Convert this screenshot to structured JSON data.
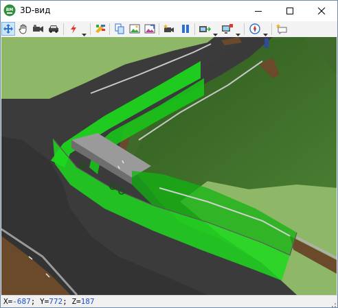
{
  "window": {
    "title": "3D-вид",
    "app_icon_text": "BM"
  },
  "toolbar": {
    "buttons": [
      {
        "name": "move-tool",
        "icon": "four-arrows-icon",
        "active": true
      },
      {
        "name": "pan-hand",
        "icon": "hand-icon"
      },
      {
        "name": "camera-view",
        "icon": "camera-icon"
      },
      {
        "name": "vehicle-view",
        "icon": "car-icon"
      },
      {
        "name": "effects",
        "icon": "lightning-icon",
        "dropdown": true
      },
      {
        "name": "surface-style",
        "icon": "palette-icon"
      },
      {
        "name": "copy-image",
        "icon": "copy-icon"
      },
      {
        "name": "save-image",
        "icon": "picture-icon"
      },
      {
        "name": "export-image",
        "icon": "picture-arrow-icon"
      },
      {
        "name": "record-video",
        "icon": "video-star-icon"
      },
      {
        "name": "pause",
        "icon": "pause-icon"
      },
      {
        "name": "fly-through",
        "icon": "film-arrow-icon",
        "dropdown": true
      },
      {
        "name": "screen-capture",
        "icon": "screen-icon",
        "dropdown": true
      },
      {
        "name": "navigation",
        "icon": "compass-icon",
        "dropdown": true
      },
      {
        "name": "annotations",
        "icon": "callout-icon"
      }
    ]
  },
  "status": {
    "x_label": "X=",
    "x_value": "-687",
    "y_label": "; Y=",
    "y_value": "772",
    "z_label": "; Z=",
    "z_value": "187"
  },
  "colors": {
    "noise_barrier": "#1cd81c",
    "asphalt": "#3a3a3a",
    "grass_slope": "#3d6e28",
    "meadow": "#8eb867",
    "bridge": "#8a8a8a",
    "coord_value": "#1a4fd0"
  }
}
